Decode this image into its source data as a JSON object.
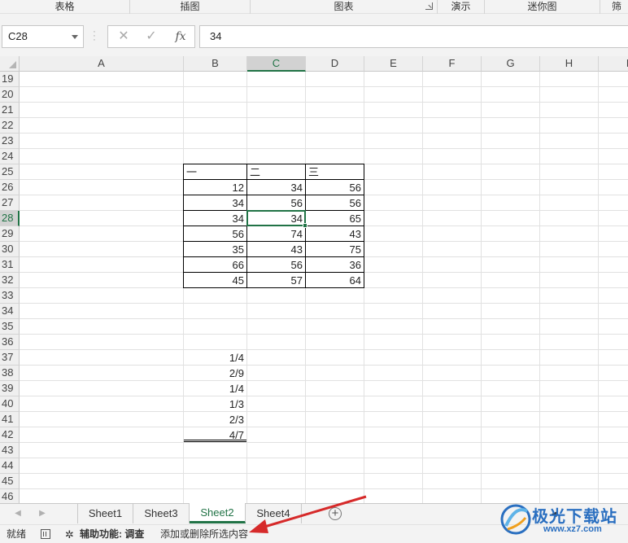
{
  "ribbon_groups": [
    {
      "label": "表格"
    },
    {
      "label": "插图"
    },
    {
      "label": "图表"
    },
    {
      "label": "演示"
    },
    {
      "label": "迷你图"
    },
    {
      "label": "筛"
    }
  ],
  "formula_bar": {
    "name_box": "C28",
    "cancel_glyph": "✕",
    "enter_glyph": "✓",
    "fx_label": "fx",
    "formula": "34"
  },
  "columns": [
    "A",
    "B",
    "C",
    "D",
    "E",
    "F",
    "G",
    "H",
    "I"
  ],
  "selected_column": "C",
  "rows": [
    "19",
    "20",
    "21",
    "22",
    "23",
    "24",
    "25",
    "26",
    "27",
    "28",
    "29",
    "30",
    "31",
    "32",
    "33",
    "34",
    "35",
    "36",
    "37",
    "38",
    "39",
    "40",
    "41",
    "42",
    "43",
    "44",
    "45",
    "46"
  ],
  "selected_row": "28",
  "table": {
    "headers": [
      "一",
      "二",
      "三"
    ],
    "rows": [
      [
        "12",
        "34",
        "56"
      ],
      [
        "34",
        "56",
        "56"
      ],
      [
        "34",
        "34",
        "65"
      ],
      [
        "56",
        "74",
        "43"
      ],
      [
        "35",
        "43",
        "75"
      ],
      [
        "66",
        "56",
        "36"
      ],
      [
        "45",
        "57",
        "64"
      ]
    ]
  },
  "fractions": [
    "1/4",
    "2/9",
    "1/4",
    "1/3",
    "2/3",
    "4/7"
  ],
  "sheet_tabs": [
    {
      "label": "Sheet1"
    },
    {
      "label": "Sheet3"
    },
    {
      "label": "Sheet2"
    },
    {
      "label": "Sheet4"
    }
  ],
  "active_sheet": "Sheet2",
  "status_bar": {
    "ready": "就绪",
    "accessibility": "辅助功能: 调查",
    "hint": "添加或删除所选内容"
  },
  "watermark": {
    "title": "极光下载站",
    "url": "www.xz7.com"
  },
  "colors": {
    "accent": "#217346",
    "annotation_arrow": "#d62a2a",
    "watermark": "#2a6fc0"
  }
}
